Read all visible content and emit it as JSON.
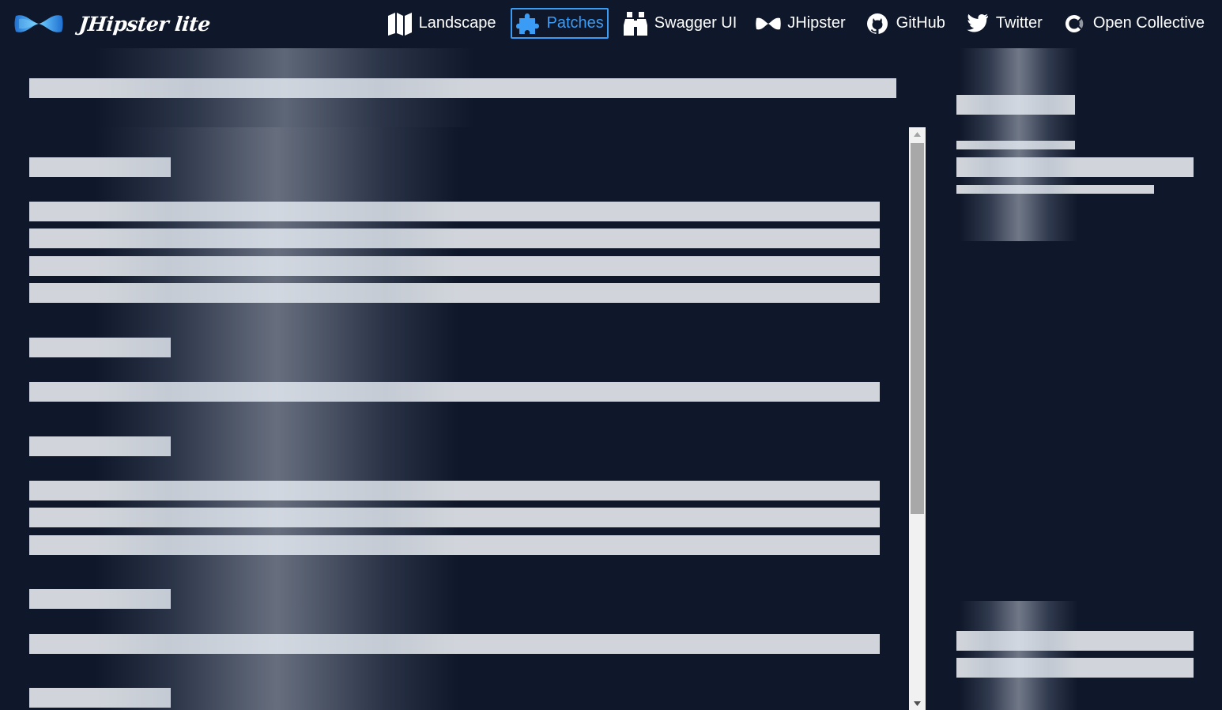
{
  "app": {
    "brand_text": "JHipster lite",
    "accent_color": "#3b9cf5",
    "background_color": "#0f172a",
    "skeleton_color": "#d1d5db"
  },
  "nav": {
    "items": [
      {
        "label": "Landscape",
        "icon": "map-icon",
        "active": false
      },
      {
        "label": "Patches",
        "icon": "puzzle-icon",
        "active": true
      },
      {
        "label": "Swagger UI",
        "icon": "binoculars-icon",
        "active": false
      },
      {
        "label": "JHipster",
        "icon": "bowtie-icon",
        "active": false
      },
      {
        "label": "GitHub",
        "icon": "github-icon",
        "active": false
      },
      {
        "label": "Twitter",
        "icon": "twitter-icon",
        "active": false
      },
      {
        "label": "Open Collective",
        "icon": "open-collective-icon",
        "active": false
      }
    ]
  },
  "loading": {
    "state": "skeleton placeholders"
  }
}
